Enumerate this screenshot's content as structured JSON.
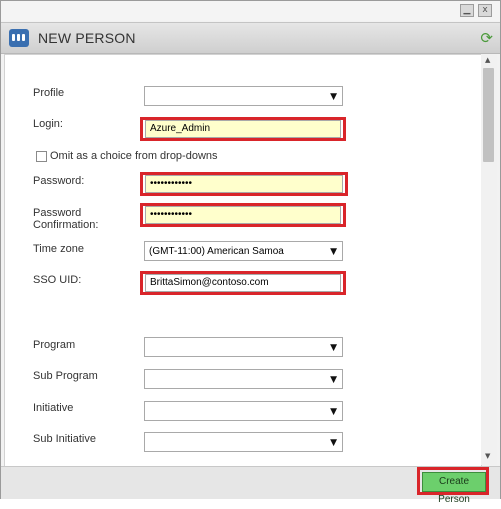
{
  "window": {
    "title": "NEW PERSON",
    "minimize_glyph": "▁",
    "close_glyph": "x",
    "refresh_glyph": "⟳",
    "app_icon": "people-app-icon"
  },
  "form": {
    "profile": {
      "label": "Profile",
      "value": ""
    },
    "login": {
      "label": "Login:",
      "value": "Azure_Admin"
    },
    "omit": {
      "label": "Omit as a choice from drop-downs",
      "checked": false
    },
    "password": {
      "label": "Password:",
      "value": "••••••••••••"
    },
    "password_confirm": {
      "label_line1": "Password",
      "label_line2": "Confirmation:",
      "value": "••••••••••••"
    },
    "timezone": {
      "label": "Time zone",
      "value": "(GMT-11:00) American Samoa"
    },
    "sso_uid": {
      "label": "SSO UID:",
      "value": "BrittaSimon@contoso.com"
    },
    "program": {
      "label": "Program",
      "value": ""
    },
    "sub_program": {
      "label": "Sub Program",
      "value": ""
    },
    "initiative": {
      "label": "Initiative",
      "value": ""
    },
    "sub_initiative": {
      "label": "Sub Initiative",
      "value": ""
    }
  },
  "dropdown_caret": "▼",
  "scroll_up": "▲",
  "scroll_down": "▼",
  "footer": {
    "create_label": "Create Person"
  },
  "colors": {
    "highlight": "#d9252a",
    "input_yellow": "#ffffcc",
    "create_button": "#6ccf6c",
    "app_icon": "#3a6fb0"
  }
}
